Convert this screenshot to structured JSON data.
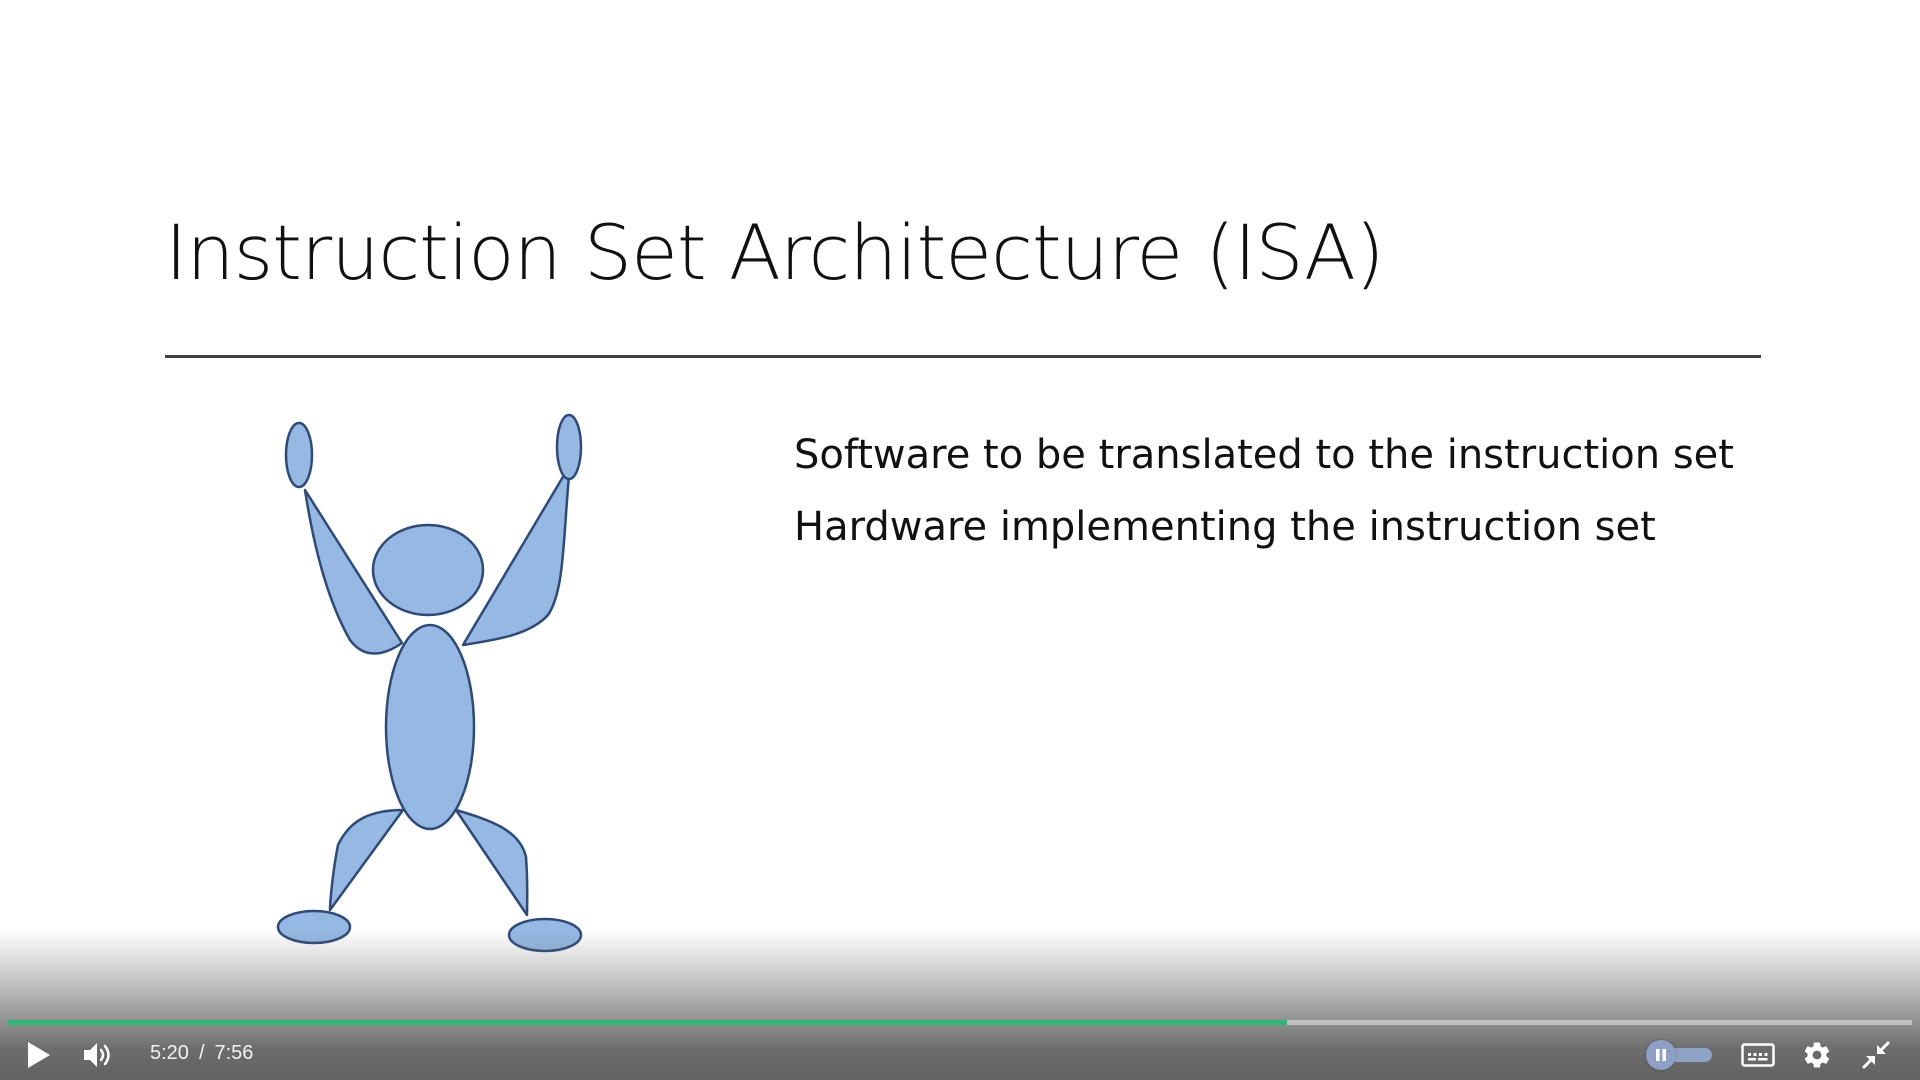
{
  "slide": {
    "title": "Instruction Set Architecture (ISA)",
    "bullets": [
      "Software to be translated to the instruction set",
      "Hardware implementing the instruction set"
    ]
  },
  "player": {
    "current_time": "5:20",
    "separator": "/",
    "duration": "7:56",
    "progress_fraction": 0.672,
    "progress_color": "#2bb673",
    "icons": [
      "play-icon",
      "volume-icon",
      "pause-icon",
      "captions-icon",
      "gear-icon",
      "exit-fullscreen-icon"
    ]
  },
  "colors": {
    "figure_fill": "#95b9e2",
    "figure_stroke": "#2e4a7a"
  }
}
